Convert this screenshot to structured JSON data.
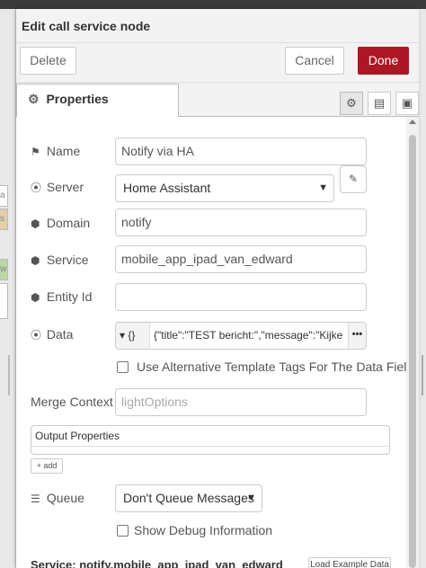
{
  "tray": {
    "title": "Edit call service node",
    "delete_label": "Delete",
    "cancel_label": "Cancel",
    "done_label": "Done"
  },
  "tabs": {
    "properties_label": "Properties"
  },
  "form": {
    "name": {
      "label": "Name",
      "value": "Notify via HA"
    },
    "server": {
      "label": "Server",
      "value": "Home Assistant"
    },
    "domain": {
      "label": "Domain",
      "value": "notify"
    },
    "service": {
      "label": "Service",
      "value": "mobile_app_ipad_van_edward"
    },
    "entity_id": {
      "label": "Entity Id",
      "value": ""
    },
    "data": {
      "label": "Data",
      "type": "{}",
      "value": "{\"title\":\"TEST bericht:\",\"message\":\"Kijke"
    },
    "alt_template_label": "Use Alternative Template Tags For The Data Field",
    "merge_context": {
      "label": "Merge Context",
      "placeholder": "lightOptions"
    },
    "output_properties_title": "Output Properties",
    "add_label": "add",
    "queue": {
      "label": "Queue",
      "value": "Don't Queue Messages"
    },
    "debug_label": "Show Debug Information",
    "service_line": "Service: notify.mobile_app_ipad_van_edward",
    "load_example_label": "Load Example Data"
  },
  "background": {
    "left_chip_texts": [
      "a",
      "s",
      "w"
    ]
  }
}
